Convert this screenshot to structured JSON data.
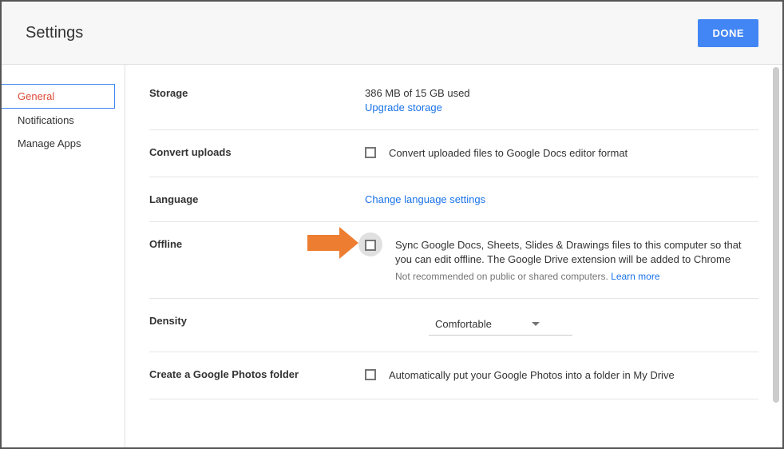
{
  "header": {
    "title": "Settings",
    "done_label": "DONE"
  },
  "sidebar": {
    "items": [
      {
        "label": "General",
        "active": true
      },
      {
        "label": "Notifications",
        "active": false
      },
      {
        "label": "Manage Apps",
        "active": false
      }
    ]
  },
  "sections": {
    "storage": {
      "label": "Storage",
      "usage": "386 MB of 15 GB used",
      "upgrade_link": "Upgrade storage"
    },
    "convert": {
      "label": "Convert uploads",
      "checkbox_label": "Convert uploaded files to Google Docs editor format"
    },
    "language": {
      "label": "Language",
      "link": "Change language settings"
    },
    "offline": {
      "label": "Offline",
      "checkbox_label": "Sync Google Docs, Sheets, Slides & Drawings files to this computer so that you can edit offline. The Google Drive extension will be added to Chrome",
      "hint": "Not recommended on public or shared computers. ",
      "learn_more": "Learn more"
    },
    "density": {
      "label": "Density",
      "value": "Comfortable"
    },
    "photos": {
      "label": "Create a Google Photos folder",
      "checkbox_label": "Automatically put your Google Photos into a folder in My Drive"
    }
  }
}
